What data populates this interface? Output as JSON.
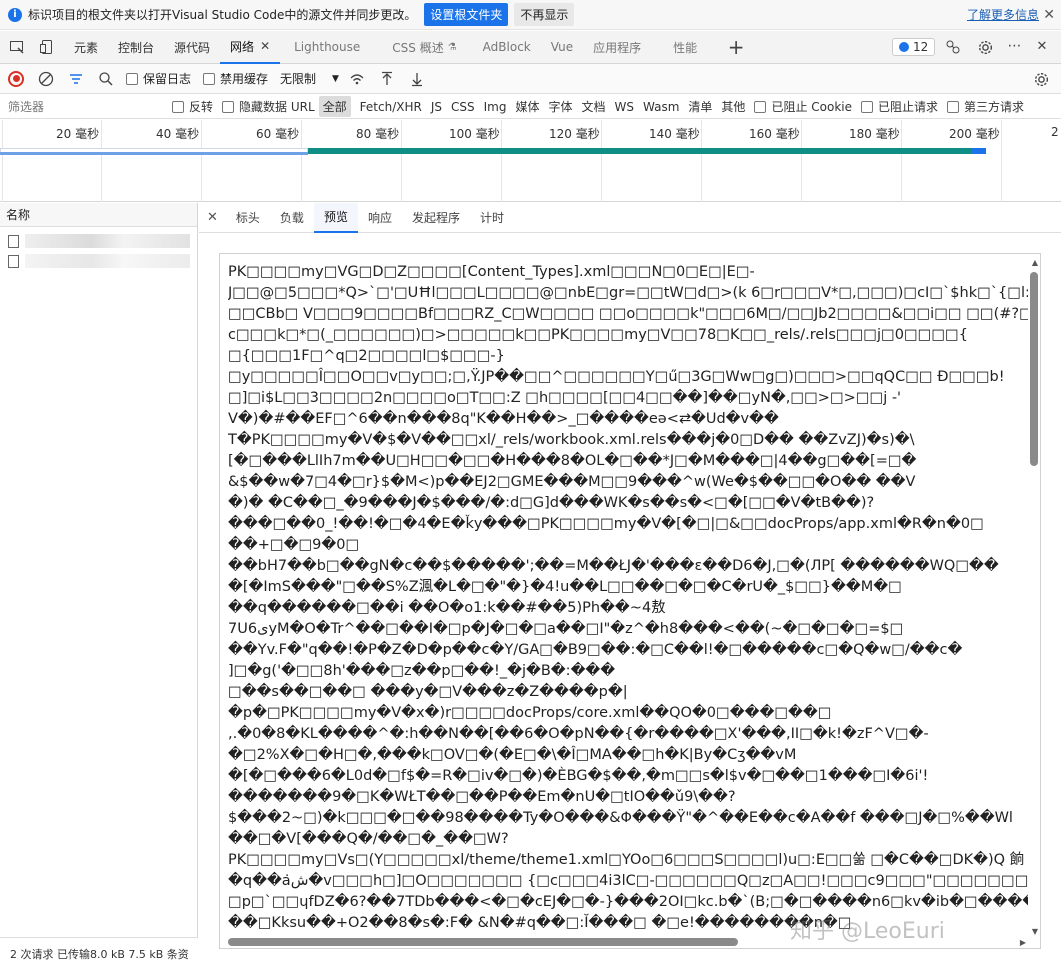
{
  "infobar": {
    "message": "标识项目的根文件夹以打开Visual Studio Code中的源文件并同步更改。",
    "set_root_button": "设置根文件夹",
    "dont_show_button": "不再显示",
    "learn_more": "了解更多信息",
    "close": "✕"
  },
  "main_tabs": [
    {
      "label": "元素"
    },
    {
      "label": "控制台"
    },
    {
      "label": "源代码"
    },
    {
      "label": "网络",
      "active": true
    },
    {
      "label": "Lighthouse"
    },
    {
      "label": "CSS 概述"
    },
    {
      "label": "AdBlock"
    },
    {
      "label": "Vue"
    },
    {
      "label": "应用程序"
    },
    {
      "label": "性能"
    }
  ],
  "issues_count": "12",
  "toolbar": {
    "preserve_log": "保留日志",
    "disable_cache": "禁用缓存",
    "throttle": "无限制"
  },
  "filter": {
    "placeholder": "筛选器",
    "invert": "反转",
    "hide_data_url": "隐藏数据 URL",
    "types": [
      "全部",
      "Fetch/XHR",
      "JS",
      "CSS",
      "Img",
      "媒体",
      "字体",
      "文档",
      "WS",
      "Wasm",
      "清单",
      "其他"
    ],
    "blocked_cookies": "已阻止 Cookie",
    "blocked_requests": "已阻止请求",
    "third_party": "第三方请求"
  },
  "timeline": {
    "ticks": [
      "20 毫秒",
      "40 毫秒",
      "60 毫秒",
      "80 毫秒",
      "100 毫秒",
      "120 毫秒",
      "140 毫秒",
      "160 毫秒",
      "180 毫秒",
      "200 毫秒",
      "2"
    ]
  },
  "left_pane": {
    "header": "名称",
    "status": "2 次请求   已传输8.0 kB   7.5 kB 条资"
  },
  "detail_tabs": [
    "标头",
    "负载",
    "预览",
    "响应",
    "发起程序",
    "计时"
  ],
  "preview_lines": [
    "PK□□□□my□VG□D□Z□□□□[Content_Types].xml□□□N□0□E□|E□-",
    "J□□@□5□□□*Q>`□'□UĦl□□□L□□□□@□nbE□gr=□□tW□d□>(k 6□r□□□V*□,□□□)□cI□`$hk□`{□l:□□/",
    "□□CBb□ V□□□9□□□□Bf□□□RZ_C□W□□□□ □□o□□□□k\"□□□6M□/□□Jb2□□□□&□□i□□ □□(#?□X?",
    "c□□□k□*□(_□□□□□□)□>□□□□□k□□PK□□□□my□V□□78□K□□_rels/.rels□□□j□0□□□□{",
    "□{□□□1F□^q□2□□□□l□$□□□-}",
    "□y□□□□□Î□□O□□v□y□□;□,Ÿ.JP��□□^□□□□□□Y□ű□3G□Ww□g□)□□□>□□qQC□□ Đ□□□b!",
    "□]□i$L□□3□□□□2n□□□□o□T□□:Z □h□□□□[□□4□□��]��□yN�,□□>□>□□j -'",
    "V�)�#��EF□^6��n���8q\"K��H��>_□����eə<⇄�Ud�v��",
    "T�PK□□□□my�V�$�V��□□xl/_rels/workbook.xml.rels���j�0□D�� ��ZvZJ)�s)�\\",
    "[�□���LlIh7m��U□H□□�□□�H���8�OL�□��*J□�M���□|4��g□��[=□�",
    "&$��w�7□4�□r}$�M<)p��EJ2□GME���M□□9���^w(We�$��□□�O�� ��V",
    "�)� �C��□_�9���J�$���/�:d□G]d���WK�s��s�<□�[□□�V�tB��)?",
    "���□��0_!��!�□�4�E�ǩy���□PK□□□□my�V�[�□|□&□□docProps/app.xml�R�n�0□",
    "��+□�□9�0□",
    "��bH7��b□��gN�c��$�����';��=M��ŁJ�'���ɛ��D6�J,□�(ЛP[ ������WQ□��",
    "�[�ImS���\"□��S%Z渢�L�□�\"�}�4!u��L□□��□�□�C�rU�_$□□}��M�□",
    "��q������□��i ��O�o1:k��#��5)Ph��~4敖",
    "7U6یyM�O�Tr^��□��I�□p�J�□�□a��□I\"�z^�h8���<��(~�□�□�□=$□",
    "��Yv.F�\"q��!�P�Z�D�p��c�Y/GA□�B9□��:�□C��l!�□�����c□�Q�w□/��c�",
    "]□�g('�□□8h'���□z��p□��!_�j�B�:���",
    "□��s��□��□ ���y�□V���z�Z����p�|",
    "�p�□PK□□□□my�V�x�)r□□□□docProps/core.xml��QO�0□���□��□",
    ",.�0�8�KL����^�:h��N��[��6�O�pN��{�r����□X'���,II□�k!�zF^V□�-",
    "�□2%X�□�H□�,���k□OV□�(�E□�\\�Î□MA��□h�K|By�Cʒ��vM",
    "�[�□���6�L0d�□f$�=R�□iv�□�)�ÈBG�$��,�m□□s�l$v�□��□1���□I�6i'!",
    "�������9�□K�WŁT��□��P��Em�nU�□tIO��ǔ9\\��?",
    "$���2~□)�k□□□�□��98����Ty�O���&Φ���Ÿ\"�^��E��c�A��f ���□J�□%��Wl",
    "��□�V[���Q�/��□�_��□W?",
    "PK□□□□my□Vs□(Y□□□□□xl/theme/theme1.xml□YOo□6□□□S□□□□l)u□:E□□쑮 □�C��□DK�)Q 餉",
    "�q��aش̇�v□□□h□]□O□□□□□□□ {□c□□□4i3lC□-□□□□□□Q□z□A□□!□□□c9□□□\"□□□□□□□□pp□m!",
    "□p□`□□ɥfDZ�6?��7TDb���<�□�cEJ�□�-}���2OI□kc.b�`(B;□�□����n6□kv�ib�□����□xL}",
    "��□Kksu��+O2��8�s�:F� &N�#q��□:Ĭ���□ �□e!��������n�□"
  ],
  "watermark": "知乎 @LeoEuri"
}
